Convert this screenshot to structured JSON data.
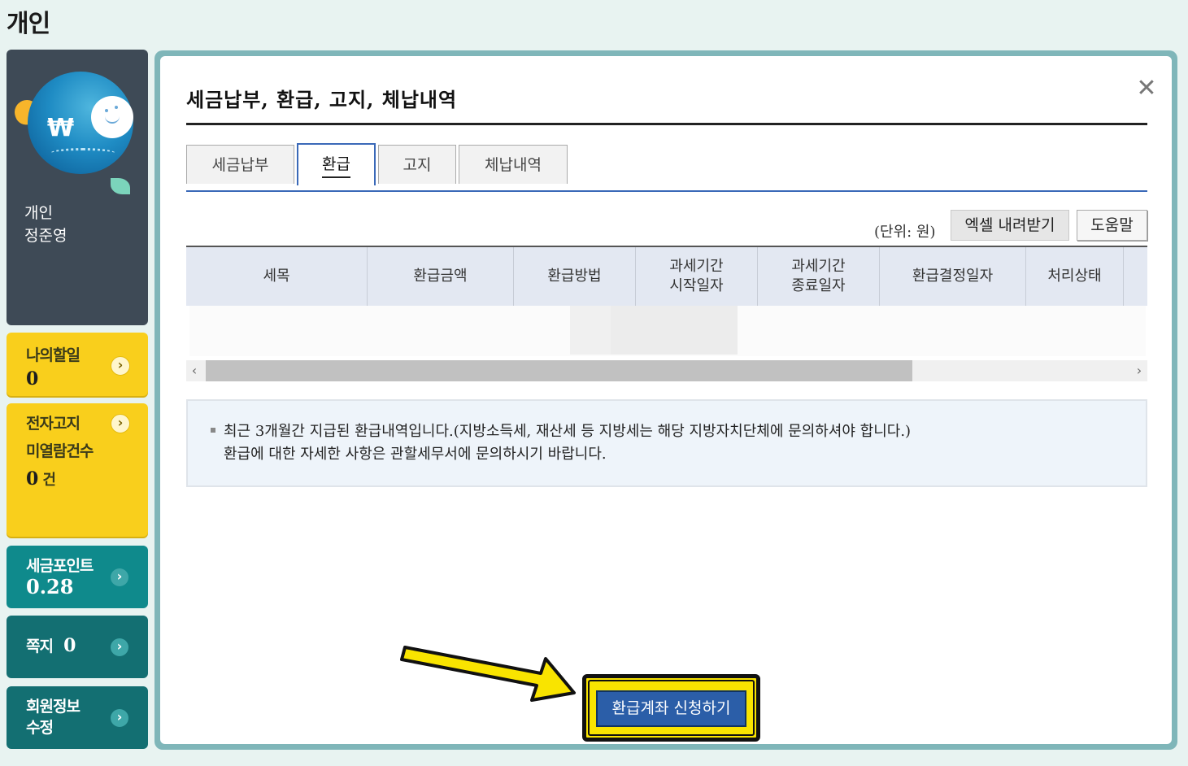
{
  "page": {
    "title": "개인"
  },
  "sidebar": {
    "profile": {
      "type": "개인",
      "name": "정준영",
      "avatar_symbol": "₩"
    },
    "cards": {
      "my_todo": {
        "label": "나의할일",
        "count": "0"
      },
      "e_notice": {
        "label_line1": "전자고지",
        "label_line2": "미열람건수",
        "count": "0",
        "unit": "건"
      },
      "tax_points": {
        "label": "세금포인트",
        "value": "0.28"
      },
      "messages": {
        "label": "쪽지",
        "count": "0"
      },
      "member_info": {
        "label_line1": "회원정보",
        "label_line2": "수정"
      }
    },
    "arrow_icon": "›"
  },
  "modal": {
    "title": "세금납부, 환급, 고지, 체납내역",
    "close_icon": "✕",
    "tabs": [
      {
        "label": "세금납부",
        "active": false
      },
      {
        "label": "환급",
        "active": true
      },
      {
        "label": "고지",
        "active": false
      },
      {
        "label": "체납내역",
        "active": false
      }
    ],
    "unit_label": "(단위: 원)",
    "excel_button": "엑셀 내려받기",
    "help_button": "도움말",
    "table": {
      "columns": [
        {
          "line1": "세목",
          "line2": ""
        },
        {
          "line1": "환급금액",
          "line2": ""
        },
        {
          "line1": "환급방법",
          "line2": ""
        },
        {
          "line1": "과세기간",
          "line2": "시작일자"
        },
        {
          "line1": "과세기간",
          "line2": "종료일자"
        },
        {
          "line1": "환급결정일자",
          "line2": ""
        },
        {
          "line1": "처리상태",
          "line2": ""
        }
      ],
      "scroll_left_icon": "‹",
      "scroll_right_icon": "›"
    },
    "notice": {
      "line1": "최근 3개월간 지급된 환급내역입니다.(지방소득세, 재산세 등 지방세는 해당 지방자치단체에 문의하셔야 합니다.)",
      "line2": "환급에 대한 자세한 사항은 관할세무서에 문의하시기 바랍니다."
    },
    "cta_button": "환급계좌 신청하기"
  },
  "colors": {
    "yellow_card": "#f9cf1c",
    "teal_card": "#0f8a8c",
    "modal_border": "#7fb6b9",
    "cta_blue": "#2b5ea8",
    "highlight_yellow": "#f9e400"
  }
}
